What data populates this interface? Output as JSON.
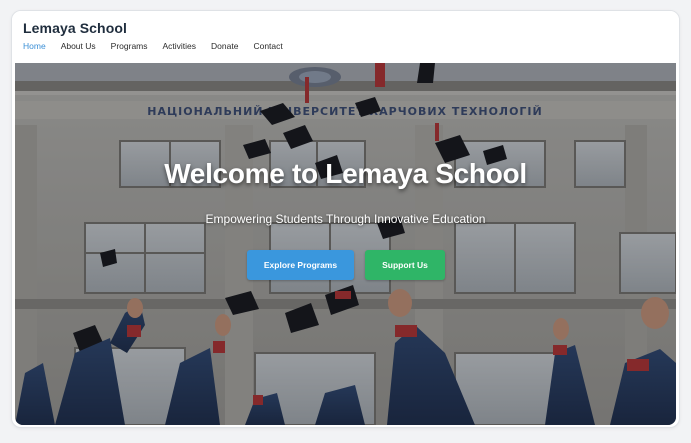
{
  "brand": "Lemaya School",
  "nav": [
    {
      "label": "Home",
      "active": true
    },
    {
      "label": "About Us"
    },
    {
      "label": "Programs"
    },
    {
      "label": "Activities"
    },
    {
      "label": "Donate"
    },
    {
      "label": "Contact"
    }
  ],
  "hero": {
    "title": "Welcome to Lemaya School",
    "subtitle": "Empowering Students Through Innovative Education",
    "primary_button": "Explore Programs",
    "secondary_button": "Support Us",
    "building_sign": "НАЦІОНАЛЬНИЙ УНІВЕРСИТЕТ ХАРЧОВИХ ТЕХНОЛОГІЙ"
  },
  "colors": {
    "accent": "#3b8fd6",
    "primary_button": "#3a97dd",
    "success_button": "#2fb567"
  }
}
